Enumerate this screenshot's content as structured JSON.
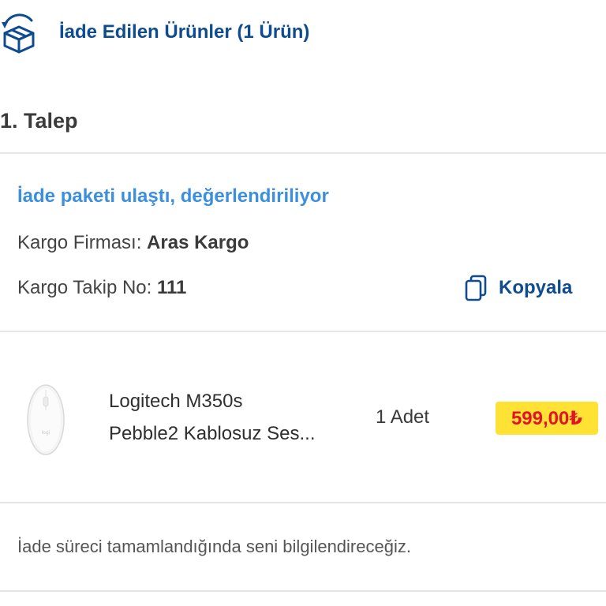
{
  "header": {
    "icon": "return-box-icon",
    "title": "İade Edilen Ürünler (1 Ürün)"
  },
  "request": {
    "title": "1. Talep"
  },
  "shipment": {
    "status": "İade paketi ulaştı, değerlendiriliyor",
    "carrier_label": "Kargo Firması: ",
    "carrier_value": "Aras Kargo",
    "tracking_label": "Kargo Takip No: ",
    "tracking_value": "111",
    "copy_label": "Kopyala",
    "copy_icon": "copy-icon"
  },
  "product": {
    "image": "mouse-product-image",
    "name_line1": "Logitech M350s",
    "name_line2": "Pebble2 Kablosuz Ses...",
    "quantity": "1 Adet",
    "price": "599,00₺"
  },
  "footer": {
    "note": "İade süreci tamamlandığında seni bilgilendireceğiz."
  },
  "colors": {
    "brand_blue": "#0f4c8f",
    "status_blue": "#3b8fdd",
    "price_badge_bg": "#ffe234",
    "price_text": "#e5102a"
  }
}
